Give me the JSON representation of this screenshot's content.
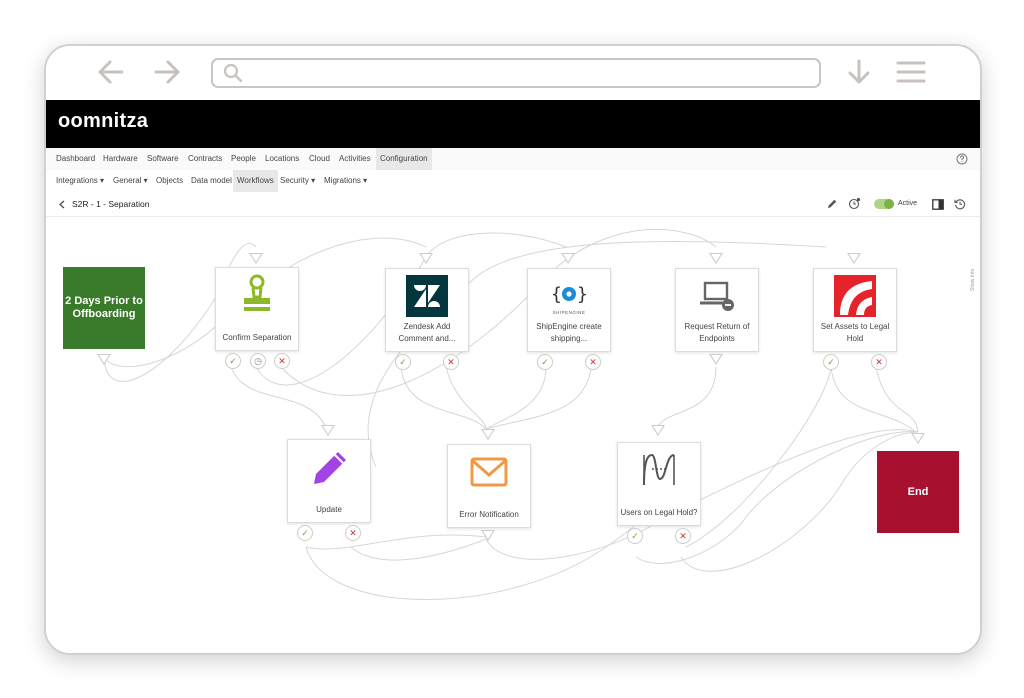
{
  "browser": {
    "url_placeholder": ""
  },
  "app": {
    "logo_text": "oomnitza"
  },
  "menu_top": [
    "Dashboard",
    "Hardware",
    "Software",
    "Contracts",
    "People",
    "Locations",
    "Cloud",
    "Activities",
    "Configuration"
  ],
  "menu_sub": [
    "Integrations ▾",
    "General ▾",
    "Objects",
    "Data model",
    "Workflows",
    "Security ▾",
    "Migrations ▾"
  ],
  "workflow": {
    "title": "S2R - 1 - Separation",
    "status_label": "Active",
    "side_tab": "Show Info"
  },
  "nodes": {
    "start": "2 Days Prior to Offboarding",
    "confirm": "Confirm Separation",
    "zendesk": "Zendesk Add Comment and...",
    "shipengine": "ShipEngine create shipping...",
    "request": "Request Return of Endpoints",
    "legal": "Set Assets to Legal Hold",
    "update": "Update",
    "error": "Error Notification",
    "users": "Users on Legal Hold?",
    "end": "End",
    "shipengine_logo": "SHIPENGINE"
  },
  "colors": {
    "start": "#3a7a2b",
    "end": "#a8102f",
    "toggle": "#7cb342"
  }
}
